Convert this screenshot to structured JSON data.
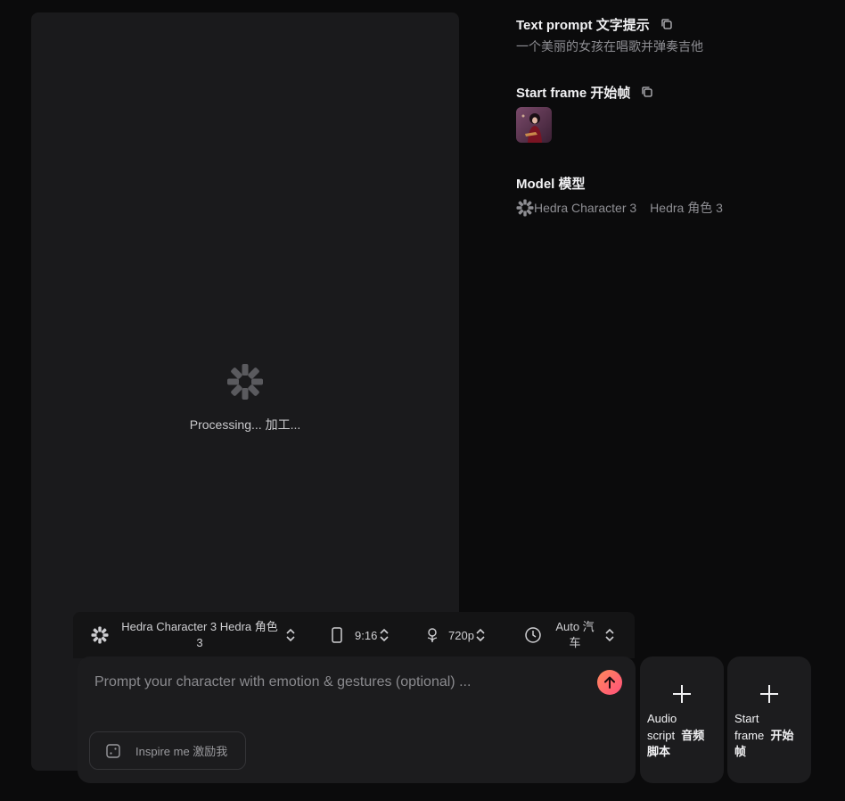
{
  "preview": {
    "status": "Processing...  加工..."
  },
  "info": {
    "text_prompt": {
      "label": "Text prompt  文字提示",
      "value": "一个美丽的女孩在唱歌并弹奏吉他"
    },
    "start_frame": {
      "label": "Start frame  开始帧"
    },
    "model": {
      "label": "Model  模型",
      "name": "Hedra Character 3",
      "name_cn": "Hedra 角色 3"
    }
  },
  "toolbar": {
    "model": {
      "line1": "Hedra Character 3  Hedra 角色",
      "line2": "3"
    },
    "aspect": "9:16",
    "resolution": "720p",
    "duration": {
      "line1": "Auto  汽",
      "line2": "车"
    }
  },
  "composer": {
    "placeholder": "Prompt your character with emotion & gestures (optional) ...",
    "inspire": "Inspire me  激励我"
  },
  "cards": {
    "audio": {
      "en1": "Audio",
      "en2": "script",
      "cn": "音频",
      "cn2": "脚本"
    },
    "frame": {
      "en1": "Start",
      "en2": "frame",
      "cn": "开始",
      "cn2": "帧"
    }
  },
  "colors": {
    "background": "#0b0b0c",
    "panel": "#1a1a1c",
    "accent_start": "#ff8a5c",
    "accent_end": "#ff4f7a"
  }
}
